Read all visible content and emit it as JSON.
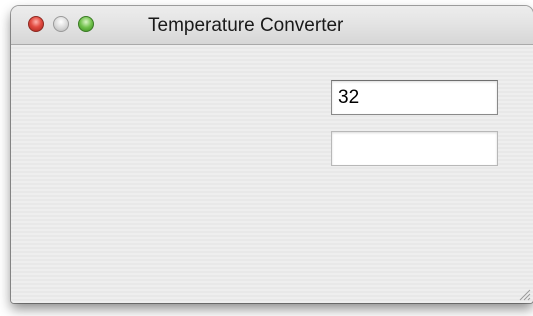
{
  "window": {
    "title": "Temperature Converter"
  },
  "fields": {
    "first_value": "32",
    "second_value": ""
  },
  "colors": {
    "close": "#e24b41",
    "minimize": "#d8d8d8",
    "zoom": "#6fc04a"
  },
  "icons": {
    "close": "close-button-icon",
    "minimize": "minimize-button-icon",
    "zoom": "zoom-button-icon",
    "resize": "resize-grip-icon"
  }
}
